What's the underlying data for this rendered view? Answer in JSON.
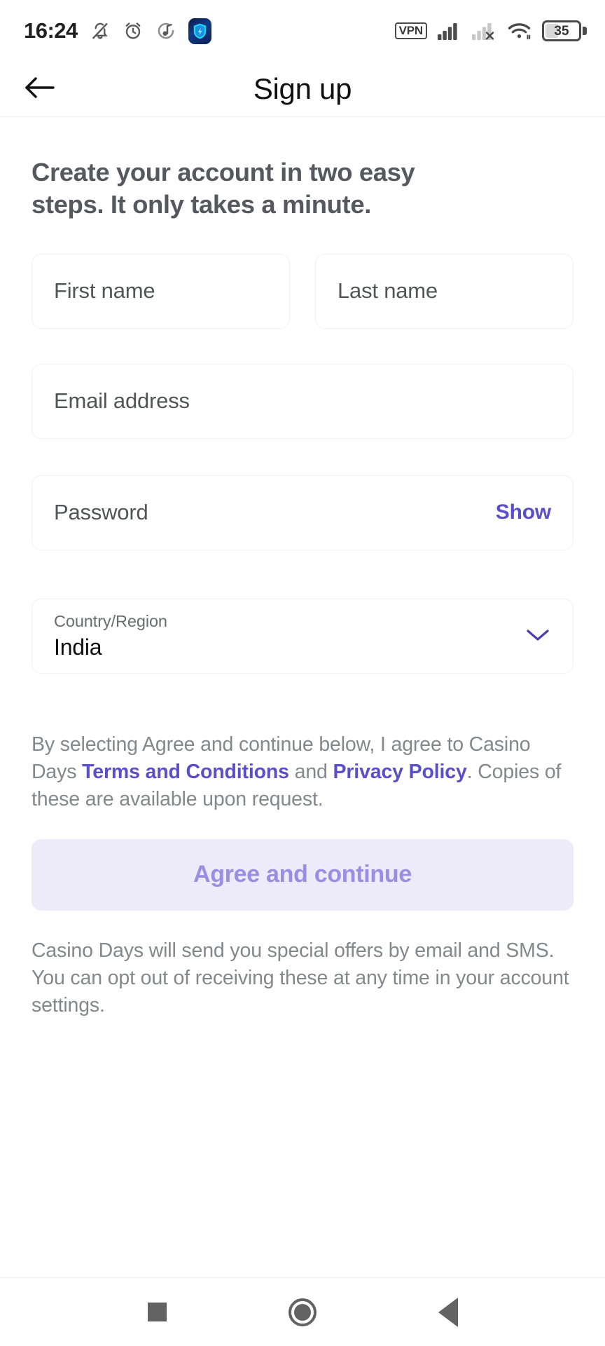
{
  "status_bar": {
    "time": "16:24",
    "battery_percent": "35",
    "vpn_label": "VPN",
    "icons": [
      "bell-muted-icon",
      "alarm-clock-icon",
      "music-note-icon",
      "vpn-app-icon",
      "vpn-badge-icon",
      "cellular-signal-icon",
      "cellular-no-service-icon",
      "wifi-icon",
      "battery-icon"
    ]
  },
  "app_bar": {
    "title": "Sign up",
    "back_icon": "back-arrow-icon"
  },
  "main": {
    "lede": "Create your account in two easy steps. It only takes a minute.",
    "fields": {
      "first_name": {
        "placeholder": "First name",
        "value": ""
      },
      "last_name": {
        "placeholder": "Last name",
        "value": ""
      },
      "email": {
        "placeholder": "Email address",
        "value": ""
      },
      "password": {
        "placeholder": "Password",
        "value": "",
        "toggle_label": "Show"
      },
      "country": {
        "label": "Country/Region",
        "value": "India",
        "chevron_icon": "chevron-down-icon"
      }
    },
    "legal": {
      "part1": "By selecting Agree and continue below, I agree to Casino Days ",
      "terms_link": "Terms and Conditions",
      "part2": " and ",
      "privacy_link": "Privacy Policy",
      "part3": ". Copies of these are available upon request."
    },
    "cta_label": "Agree and continue",
    "footnote": "Casino Days will send you special offers by email and SMS. You can opt out of receiving these at any time in your account settings."
  },
  "nav_bar": {
    "recents_icon": "recents-square-icon",
    "home_icon": "home-circle-icon",
    "back_icon": "back-triangle-icon"
  },
  "colors": {
    "accent_purple": "#5b4ec9",
    "cta_background": "#edeaf9",
    "cta_text": "#9a8ee2",
    "heading_text": "#55585e",
    "muted_text": "#85878d",
    "field_border": "#f1f1f3"
  }
}
